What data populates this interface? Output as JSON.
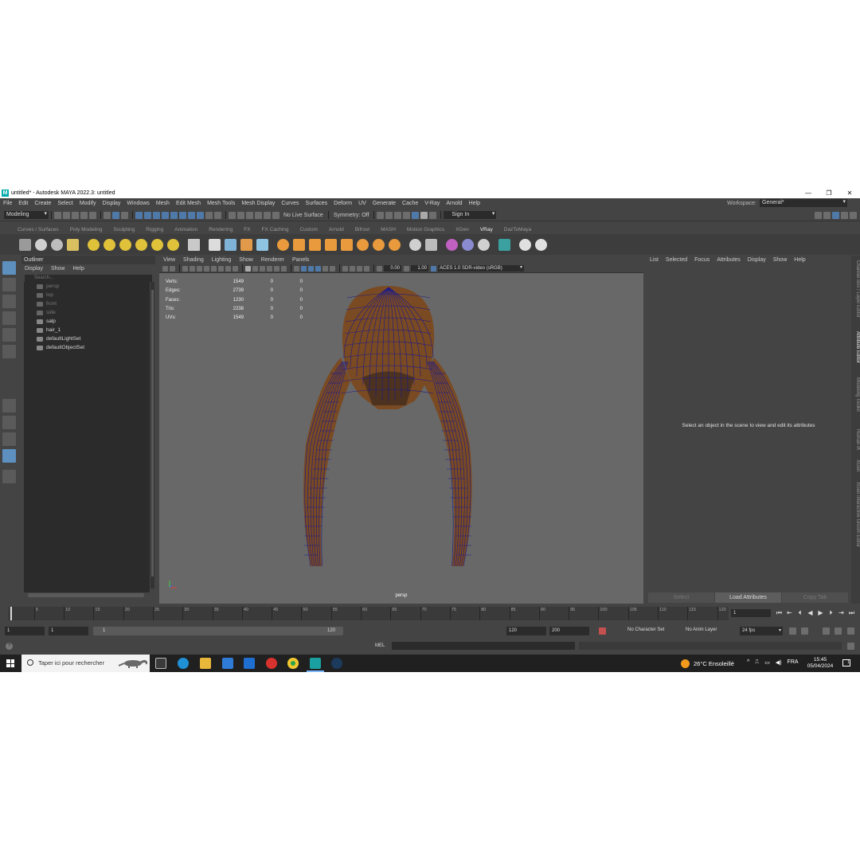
{
  "window": {
    "title": "untitled* - Autodesk MAYA 2022.3: untitled",
    "minimize": "—",
    "restore": "❐",
    "close": "✕"
  },
  "menu": [
    "File",
    "Edit",
    "Create",
    "Select",
    "Modify",
    "Display",
    "Windows",
    "Mesh",
    "Edit Mesh",
    "Mesh Tools",
    "Mesh Display",
    "Curves",
    "Surfaces",
    "Deform",
    "UV",
    "Generate",
    "Cache",
    "V-Ray",
    "Arnold",
    "Help"
  ],
  "workspace": {
    "label": "Workspace:",
    "value": "General*"
  },
  "statusline": {
    "mode": "Modeling",
    "live_surface": "No Live Surface",
    "symmetry": "Symmetry: Off",
    "sign_in": "Sign In"
  },
  "shelf_tabs": [
    {
      "label": "Curves / Surfaces",
      "active": false
    },
    {
      "label": "Poly Modeling",
      "active": false
    },
    {
      "label": "Sculpting",
      "active": false
    },
    {
      "label": "Rigging",
      "active": false
    },
    {
      "label": "Animation",
      "active": false
    },
    {
      "label": "Rendering",
      "active": false
    },
    {
      "label": "FX",
      "active": false
    },
    {
      "label": "FX Caching",
      "active": false
    },
    {
      "label": "Custom",
      "active": false
    },
    {
      "label": "Arnold",
      "active": false
    },
    {
      "label": "Bifrost",
      "active": false
    },
    {
      "label": "MASH",
      "active": false
    },
    {
      "label": "Motion Graphics",
      "active": false
    },
    {
      "label": "XGen",
      "active": false
    },
    {
      "label": "VRay",
      "active": true
    },
    {
      "label": "DazToMaya",
      "active": false
    }
  ],
  "outliner": {
    "title": "Outliner",
    "menu": [
      "Display",
      "Show",
      "Help"
    ],
    "search_placeholder": "Search...",
    "items": [
      {
        "label": "persp",
        "kind": "cam"
      },
      {
        "label": "top",
        "kind": "cam"
      },
      {
        "label": "front",
        "kind": "cam"
      },
      {
        "label": "side",
        "kind": "cam"
      },
      {
        "label": "salp",
        "kind": "obj"
      },
      {
        "label": "hair_1",
        "kind": "obj"
      },
      {
        "label": "defaultLightSet",
        "kind": "obj"
      },
      {
        "label": "defaultObjectSet",
        "kind": "obj"
      }
    ]
  },
  "viewport": {
    "menu": [
      "View",
      "Shading",
      "Lighting",
      "Show",
      "Renderer",
      "Panels"
    ],
    "exposure": "0.00",
    "gamma": "1.00",
    "colorspace": "ACES 1.0 SDR-video (sRGB)",
    "camera": "persp",
    "hud": [
      {
        "label": "Verts:",
        "v1": "1549",
        "v2": "0",
        "v3": "0"
      },
      {
        "label": "Edges:",
        "v1": "2739",
        "v2": "0",
        "v3": "0"
      },
      {
        "label": "Faces:",
        "v1": "1230",
        "v2": "0",
        "v3": "0"
      },
      {
        "label": "Tris:",
        "v1": "2238",
        "v2": "0",
        "v3": "0"
      },
      {
        "label": "UVs:",
        "v1": "1549",
        "v2": "0",
        "v3": "0"
      }
    ],
    "hair_color": "#7a4a22",
    "wire_color": "#1a1a8c"
  },
  "attribute_editor": {
    "menu": [
      "List",
      "Selected",
      "Focus",
      "Attributes",
      "Display",
      "Show",
      "Help"
    ],
    "message": "Select an object in the scene to view and edit its attributes",
    "buttons": [
      "Select",
      "Load Attributes",
      "Copy Tab"
    ]
  },
  "side_tabs": [
    "Channel Box / Layer Editor",
    "Attribute Editor",
    "Modeling Toolkit",
    "Human IK",
    "XGen",
    "XGen Interactive Groom Editor"
  ],
  "timeline": {
    "ticks": [
      "5",
      "10",
      "15",
      "20",
      "25",
      "30",
      "35",
      "40",
      "45",
      "50",
      "55",
      "60",
      "65",
      "70",
      "75",
      "80",
      "85",
      "90",
      "95",
      "100",
      "105",
      "110",
      "115",
      "120"
    ],
    "first_tick": "1",
    "current_frame": "1"
  },
  "range": {
    "start": "1",
    "playback_start": "1",
    "bar_start": "1",
    "bar_end": "120",
    "playback_end": "120",
    "end": "200",
    "character_set": "No Character Set",
    "anim_layer": "No Anim Layer",
    "fps": "24 fps"
  },
  "command_line": {
    "mel": "MEL",
    "help": "?"
  },
  "taskbar": {
    "search_text": "Taper ici pour rechercher",
    "weather": "26°C  Ensoleillé",
    "language": "FRA",
    "time": "15:45",
    "date": "05/04/2024",
    "notifications": "1"
  }
}
